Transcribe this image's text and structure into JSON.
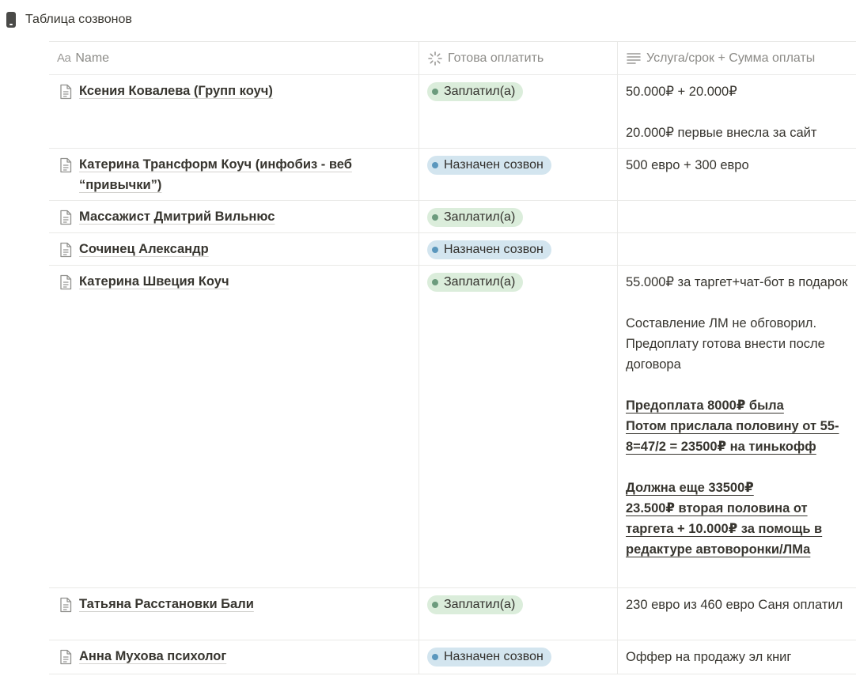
{
  "page": {
    "title": "Таблица созвонов",
    "title_icon": "phone-icon"
  },
  "columns": {
    "name": {
      "prefix": "Aa",
      "label": "Name"
    },
    "status": {
      "icon": "status-loader-icon",
      "label": "Готова оплатить"
    },
    "notes": {
      "icon": "text-lines-icon",
      "label": "Услуга/срок + Сумма оплаты"
    }
  },
  "statuses": {
    "paid": {
      "label": "Заплатил(а)",
      "bg": "#dbeddb",
      "dot": "#6c9b7d"
    },
    "scheduled": {
      "label": "Назначен созвон",
      "bg": "#d3e5ef",
      "dot": "#5b97bd"
    }
  },
  "rows": [
    {
      "name": "Ксения Ковалева (Групп коуч)",
      "status": "Заплатил(а)",
      "notes": [
        {
          "t": "50.000₽ + 20.000₽"
        },
        {
          "gap": true
        },
        {
          "t": "20.000₽ первые внесла за сайт"
        }
      ]
    },
    {
      "name": "Катерина Трансформ Коуч (инфобиз - веб “привычки”)",
      "status": "Назначен созвон",
      "notes": [
        {
          "t": "500 евро + 300 евро"
        }
      ]
    },
    {
      "name": "Массажист Дмитрий Вильнюс",
      "status": "Заплатил(а)",
      "notes": []
    },
    {
      "name": "Сочинец Александр",
      "status": "Назначен созвон",
      "notes": []
    },
    {
      "name": "Катерина Швеция Коуч",
      "status": "Заплатил(а)",
      "notes": [
        {
          "t": "55.000₽ за таргет+чат-бот в подарок"
        },
        {
          "gap": true
        },
        {
          "t": "Составление ЛМ не обговорил. Предоплату готова внести после договора"
        },
        {
          "gap": true
        },
        {
          "t": "Предоплата 8000₽ была",
          "u": true
        },
        {
          "t": "Потом прислала половину от 55-8=47/2 = 23500₽ на тинькофф",
          "u": true
        },
        {
          "gap": true
        },
        {
          "t": "Должна еще 33500₽",
          "u": true
        },
        {
          "t": "23.500₽ вторая половина от таргета + 10.000₽ за помощь в редактуре автоворонки/ЛМа",
          "u": true
        }
      ]
    },
    {
      "name": "Татьяна Расстановки Бали",
      "status": "Заплатил(а)",
      "notes": [
        {
          "t": "230 евро из 460 евро Саня оплатил"
        }
      ]
    },
    {
      "name": "Анна Мухова психолог",
      "status": "Назначен созвон",
      "notes": [
        {
          "t": "Оффер на продажу эл книг"
        }
      ]
    }
  ]
}
